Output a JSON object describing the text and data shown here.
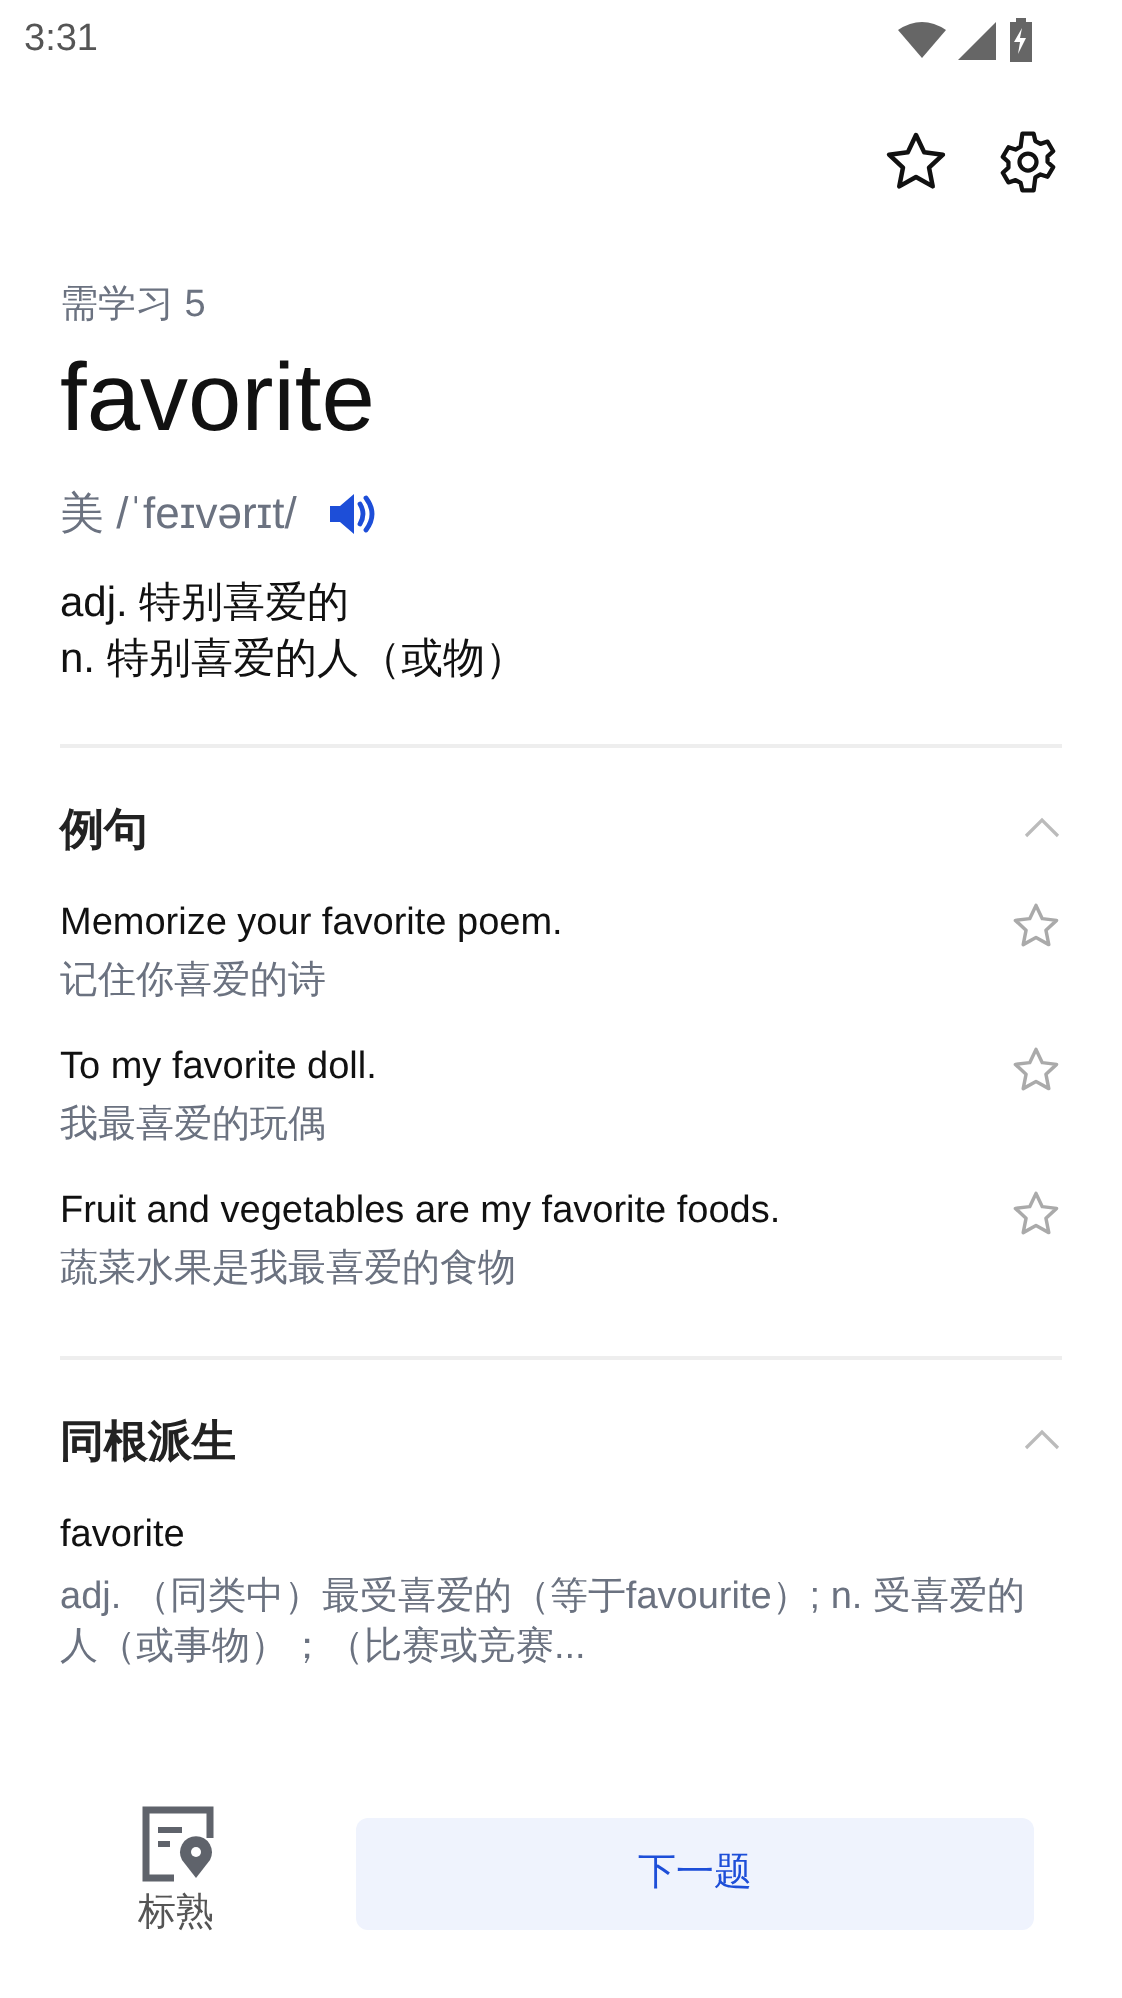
{
  "status_bar": {
    "time": "3:31"
  },
  "toolbar": {
    "favorited": false
  },
  "word": {
    "study_count": "需学习 5",
    "headword": "favorite",
    "phonetic": "美 /ˈfeɪvərɪt/",
    "definitions": [
      "adj. 特别喜爱的",
      "n. 特别喜爱的人（或物）"
    ]
  },
  "sections": [
    {
      "kind": "examples",
      "title": "例句",
      "expanded": true,
      "items": [
        {
          "en": "Memorize your favorite poem.",
          "zh": "记住你喜爱的诗",
          "starred": false
        },
        {
          "en": "To my favorite doll.",
          "zh": "我最喜爱的玩偶",
          "starred": false
        },
        {
          "en": "Fruit and vegetables are my favorite foods.",
          "zh": "蔬菜水果是我最喜爱的食物",
          "starred": false
        }
      ]
    },
    {
      "kind": "derivatives",
      "title": "同根派生",
      "expanded": true,
      "items": [
        {
          "word": "favorite",
          "meaning": "adj. （同类中）最受喜爱的（等于favourite）; n. 受喜爱的人（或事物）；（比赛或竞赛..."
        }
      ]
    }
  ],
  "bottom_bar": {
    "mark_label": "标熟",
    "next_button": "下一题"
  }
}
